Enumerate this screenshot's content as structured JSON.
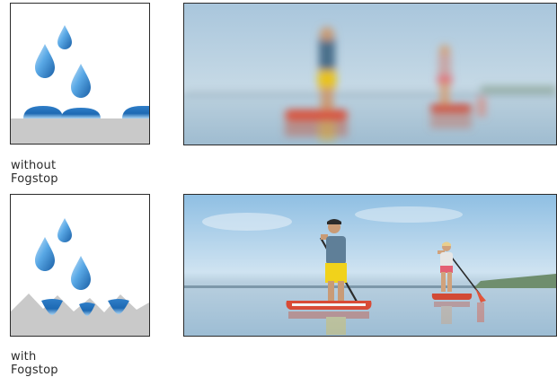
{
  "panels": [
    {
      "caption": "without Fogstop",
      "state": "foggy"
    },
    {
      "caption": "with Fogstop",
      "state": "clear"
    }
  ],
  "colors": {
    "drop_light": "#a9d3f2",
    "drop_dark": "#1f6fb8",
    "surface_gray": "#c9c9c9",
    "border": "#2b2b2b"
  }
}
